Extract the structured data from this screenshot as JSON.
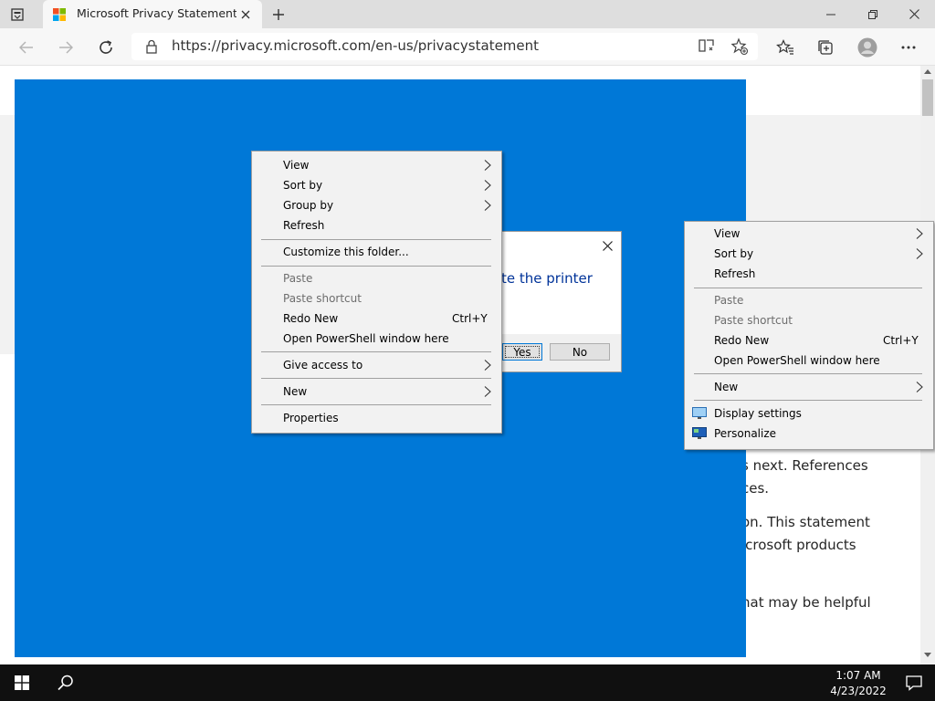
{
  "browser": {
    "tab_title": "Microsoft Privacy Statement – M",
    "url": "https://privacy.microsoft.com/en-us/privacystatement"
  },
  "webpage": {
    "fragments": [
      "s next. References",
      "ces.",
      "on. This statement",
      "icrosoft products",
      "hat may be helpful"
    ]
  },
  "dialog": {
    "text": "te the printer",
    "yes_label": "Yes",
    "no_label": "No"
  },
  "menu1": {
    "view": "View",
    "sort_by": "Sort by",
    "group_by": "Group by",
    "refresh": "Refresh",
    "customize": "Customize this folder...",
    "paste": "Paste",
    "paste_shortcut": "Paste shortcut",
    "redo_new": "Redo New",
    "redo_shortcut": "Ctrl+Y",
    "powershell": "Open PowerShell window here",
    "give_access": "Give access to",
    "new": "New",
    "properties": "Properties"
  },
  "menu2": {
    "view": "View",
    "sort_by": "Sort by",
    "refresh": "Refresh",
    "paste": "Paste",
    "paste_shortcut": "Paste shortcut",
    "redo_new": "Redo New",
    "redo_shortcut": "Ctrl+Y",
    "powershell": "Open PowerShell window here",
    "new": "New",
    "display_settings": "Display settings",
    "personalize": "Personalize"
  },
  "taskbar": {
    "time": "1:07 AM",
    "date": "4/23/2022"
  },
  "colors": {
    "desktop": "#0078d7",
    "taskbar": "#101010",
    "menu_bg": "#f2f2f2",
    "dialog_text": "#003399"
  }
}
